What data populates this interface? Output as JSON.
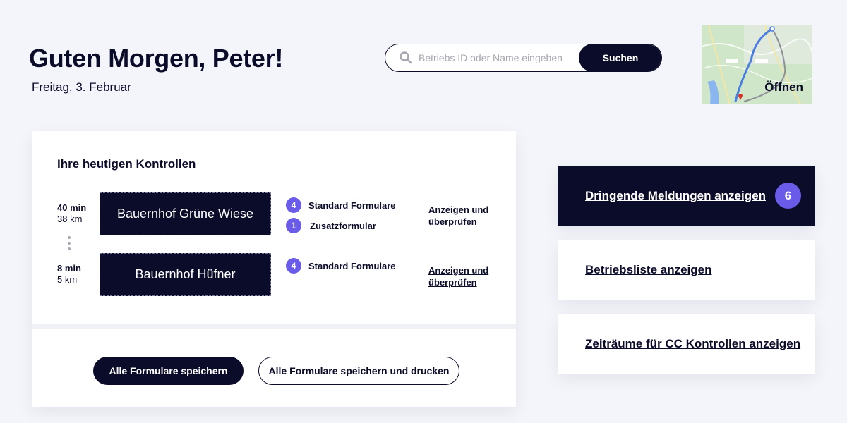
{
  "header": {
    "greeting": "Guten Morgen, Peter!",
    "date": "Freitag, 3. Februar"
  },
  "search": {
    "placeholder": "Betriebs ID oder Name eingeben",
    "value": "",
    "button_label": "Suchen",
    "icon": "search-icon"
  },
  "map": {
    "open_label": "Öffnen"
  },
  "controls": {
    "title": "Ihre heutigen Kontrollen",
    "items": [
      {
        "time": "40 min",
        "distance": "38 km",
        "farm": "Bauernhof Grüne Wiese",
        "forms": [
          {
            "count": "4",
            "label": "Standard Formulare"
          },
          {
            "count": "1",
            "label": "Zusatzformular"
          }
        ],
        "review_label": "Anzeigen und überprüfen"
      },
      {
        "time": "8 min",
        "distance": "5 km",
        "farm": "Bauernhof Hüfner",
        "forms": [
          {
            "count": "4",
            "label": "Standard Formulare"
          }
        ],
        "review_label": "Anzeigen und überprüfen"
      }
    ],
    "save_all_label": "Alle Formulare speichern",
    "save_print_label": "Alle Formulare speichern und drucken"
  },
  "panels": {
    "urgent": {
      "label": "Dringende Meldungen anzeigen",
      "count": "6"
    },
    "farm_list": {
      "label": "Betriebsliste anzeigen"
    },
    "cc_periods": {
      "label": "Zeiträume für CC Kontrollen anzeigen"
    }
  },
  "colors": {
    "navy": "#0b0b2a",
    "accent_purple": "#6a5ce8",
    "background": "#f4f5fa",
    "card": "#ffffff"
  }
}
